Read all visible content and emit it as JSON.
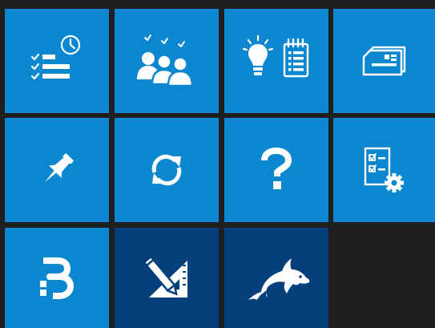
{
  "tiles": [
    {
      "icon": "checklist-clock-icon",
      "style": "light"
    },
    {
      "icon": "team-checklist-icon",
      "style": "light"
    },
    {
      "icon": "lightbulb-notepad-icon",
      "style": "light"
    },
    {
      "icon": "card-document-icon",
      "style": "light"
    },
    {
      "icon": "pin-icon",
      "style": "light"
    },
    {
      "icon": "refresh-icon",
      "style": "light"
    },
    {
      "icon": "help-question-icon",
      "style": "light"
    },
    {
      "icon": "checklist-settings-icon",
      "style": "light"
    },
    {
      "icon": "b-logo-icon",
      "style": "light"
    },
    {
      "icon": "design-tools-icon",
      "style": "dark"
    },
    {
      "icon": "dolphin-icon",
      "style": "dark"
    }
  ],
  "colors": {
    "background": "#1f1f1f",
    "tile_light": "#0b87cf",
    "tile_dark": "#053f7c",
    "icon": "#ffffff"
  }
}
